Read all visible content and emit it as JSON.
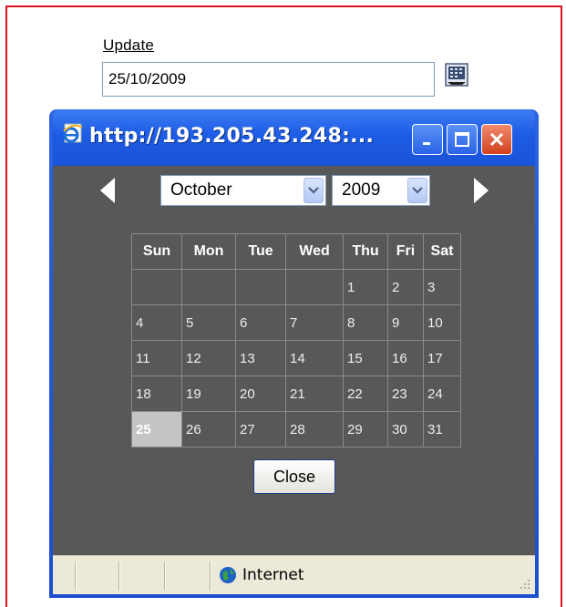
{
  "form": {
    "update_label": "Update",
    "date_value": "25/10/2009"
  },
  "window": {
    "title": "http://193.205.43.248:...",
    "calendar": {
      "month": "October",
      "year": "2009",
      "headers": [
        "Sun",
        "Mon",
        "Tue",
        "Wed",
        "Thu",
        "Fri",
        "Sat"
      ],
      "weeks": [
        [
          "",
          "",
          "",
          "",
          "1",
          "2",
          "3"
        ],
        [
          "4",
          "5",
          "6",
          "7",
          "8",
          "9",
          "10"
        ],
        [
          "11",
          "12",
          "13",
          "14",
          "15",
          "16",
          "17"
        ],
        [
          "18",
          "19",
          "20",
          "21",
          "22",
          "23",
          "24"
        ],
        [
          "25",
          "26",
          "27",
          "28",
          "29",
          "30",
          "31"
        ]
      ],
      "selected_day": "25",
      "close_label": "Close"
    },
    "status": {
      "zone": "Internet"
    }
  },
  "colors": {
    "frame_border": "#e2141b",
    "titlebar": "#1d5ce4",
    "calendar_bg": "#585858",
    "selected_cell": "#c4c4c4"
  }
}
